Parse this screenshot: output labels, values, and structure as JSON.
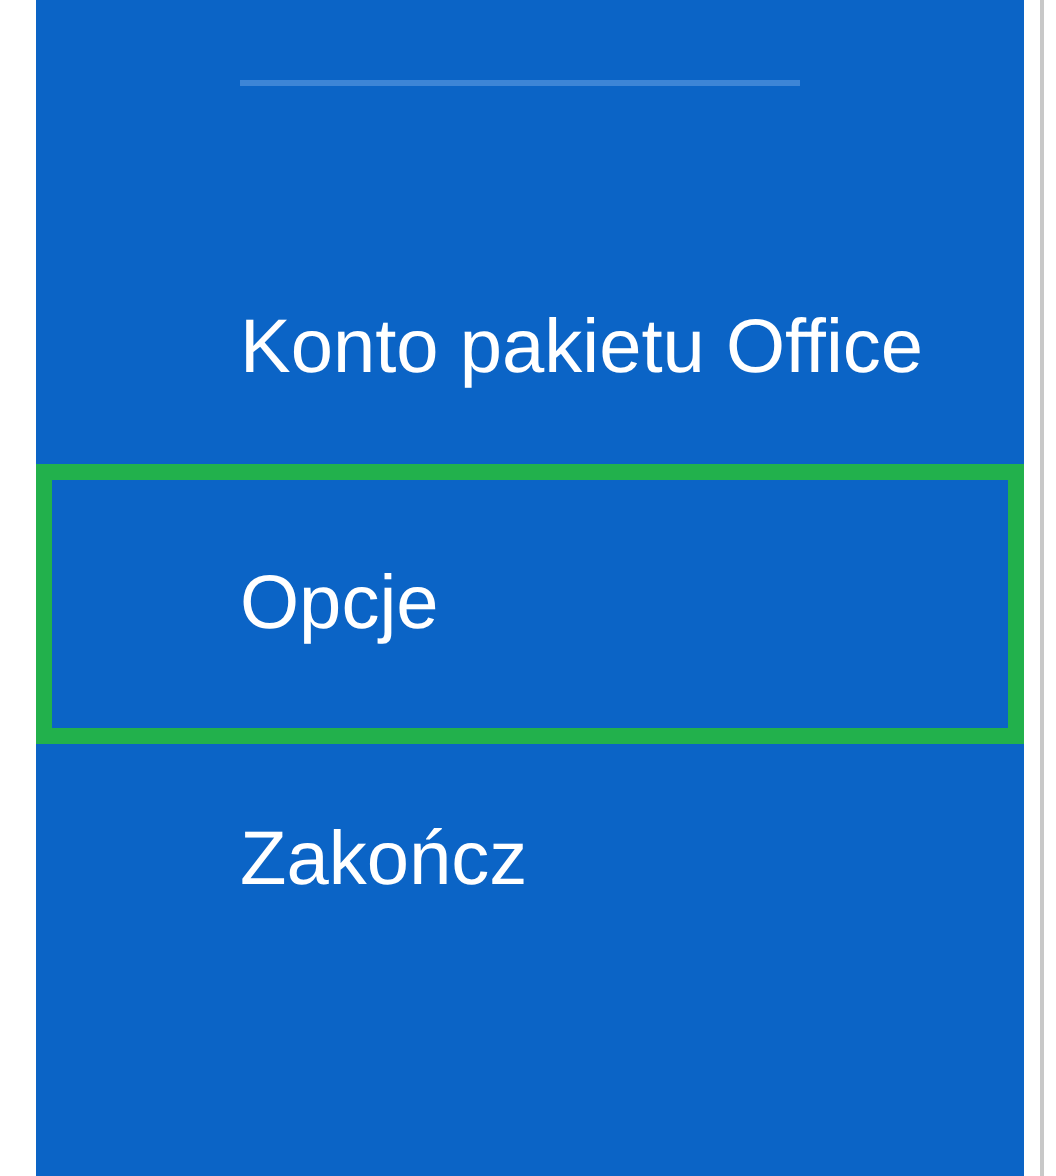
{
  "menu": {
    "items": [
      {
        "label": "Konto pakietu Office",
        "highlighted": false
      },
      {
        "label": "Opcje",
        "highlighted": true
      },
      {
        "label": "Zakończ",
        "highlighted": false
      }
    ]
  }
}
